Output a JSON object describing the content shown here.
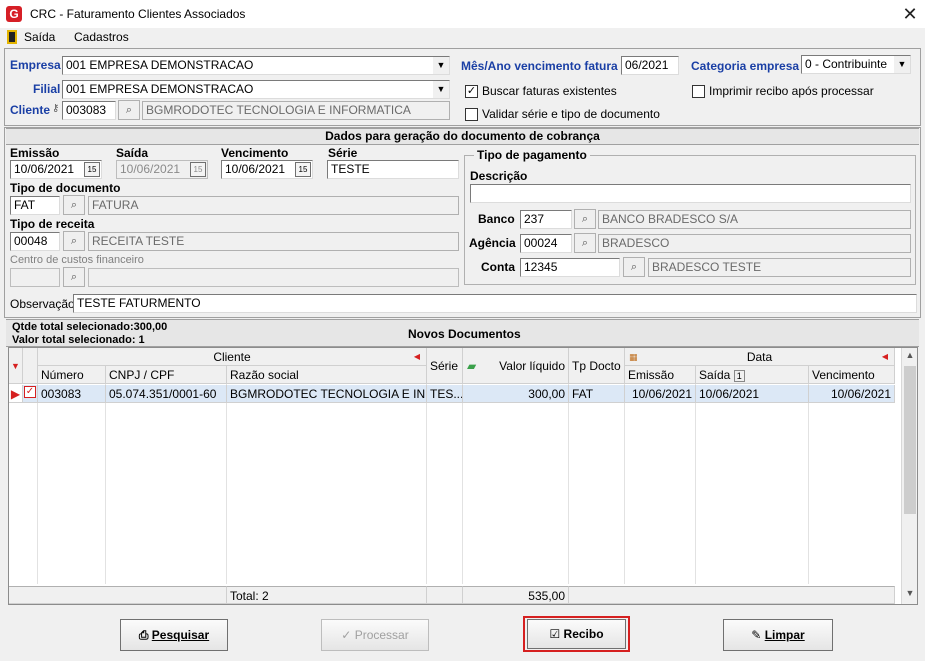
{
  "window": {
    "title": "CRC - Faturamento Clientes Associados",
    "close": "✕",
    "app_icon": "G"
  },
  "menu": {
    "items": [
      "Saída",
      "Cadastros"
    ]
  },
  "filters": {
    "empresa_label": "Empresa",
    "empresa_value": "001 EMPRESA DEMONSTRACAO",
    "filial_label": "Filial",
    "filial_value": "001 EMPRESA DEMONSTRACAO",
    "cliente_label": "Cliente",
    "cliente_code": "003083",
    "cliente_name": "BGMRODOTEC TECNOLOGIA  E INFORMATICA",
    "mes_ano_label": "Mês/Ano vencimento fatura",
    "mes_ano_value": "06/2021",
    "categoria_label": "Categoria empresa",
    "categoria_value": "0 - Contribuinte",
    "buscar_label": "Buscar faturas existentes",
    "buscar_checked": true,
    "imprimir_label": "Imprimir recibo após processar",
    "imprimir_checked": false,
    "validar_label": "Validar série e tipo de documento",
    "validar_checked": false
  },
  "doc": {
    "section_title": "Dados para geração do documento de cobrança",
    "emissao_label": "Emissão",
    "emissao_value": "10/06/2021",
    "saida_label": "Saída",
    "saida_value": "10/06/2021",
    "vencimento_label": "Vencimento",
    "vencimento_value": "10/06/2021",
    "serie_label": "Série",
    "serie_value": "TESTE",
    "tipo_doc_label": "Tipo de documento",
    "tipo_doc_code": "FAT",
    "tipo_doc_name": "FATURA",
    "tipo_receita_label": "Tipo de receita",
    "tipo_receita_code": "00048",
    "tipo_receita_name": "RECEITA TESTE",
    "centro_label": "Centro de custos financeiro",
    "observacao_label": "Observação",
    "observacao_value": "TESTE FATURMENTO",
    "cal_icon": "15"
  },
  "pagamento": {
    "group_title": "Tipo de pagamento",
    "descricao_label": "Descrição",
    "descricao_value": "",
    "banco_label": "Banco",
    "banco_code": "237",
    "banco_name": "BANCO BRADESCO S/A",
    "agencia_label": "Agência",
    "agencia_code": "00024",
    "agencia_name": "BRADESCO",
    "conta_label": "Conta",
    "conta_code": "12345",
    "conta_name": "BRADESCO TESTE"
  },
  "summary": {
    "qtde": "Qtde total selecionado:300,00",
    "valor": "Valor total selecionado: 1",
    "title": "Novos Documentos"
  },
  "grid": {
    "group_cliente": "Cliente",
    "group_data": "Data",
    "headers": [
      "Número",
      "CNPJ / CPF",
      "Razão social",
      "Série",
      "Valor líquido",
      "Tp Docto",
      "Emissão",
      "Saída",
      "Vencimento"
    ],
    "sort_badge": "1",
    "rows": [
      {
        "numero": "003083",
        "cnpj": "05.074.351/0001-60",
        "razao": "BGMRODOTEC TECNOLOGIA  E INF...",
        "serie": "TES...",
        "valor": "300,00",
        "tp": "FAT",
        "emissao": "10/06/2021",
        "saida": "10/06/2021",
        "vencimento": "10/06/2021",
        "checked": true
      }
    ],
    "footer_total": "Total: 2",
    "footer_valor": "535,00"
  },
  "buttons": {
    "pesquisar": "Pesquisar",
    "processar": "Processar",
    "recibo": "Recibo",
    "limpar": "Limpar"
  },
  "colors": {
    "accent_blue": "#1a3fa5",
    "highlight_red": "#d62020",
    "row_selected": "#dce8f6"
  }
}
